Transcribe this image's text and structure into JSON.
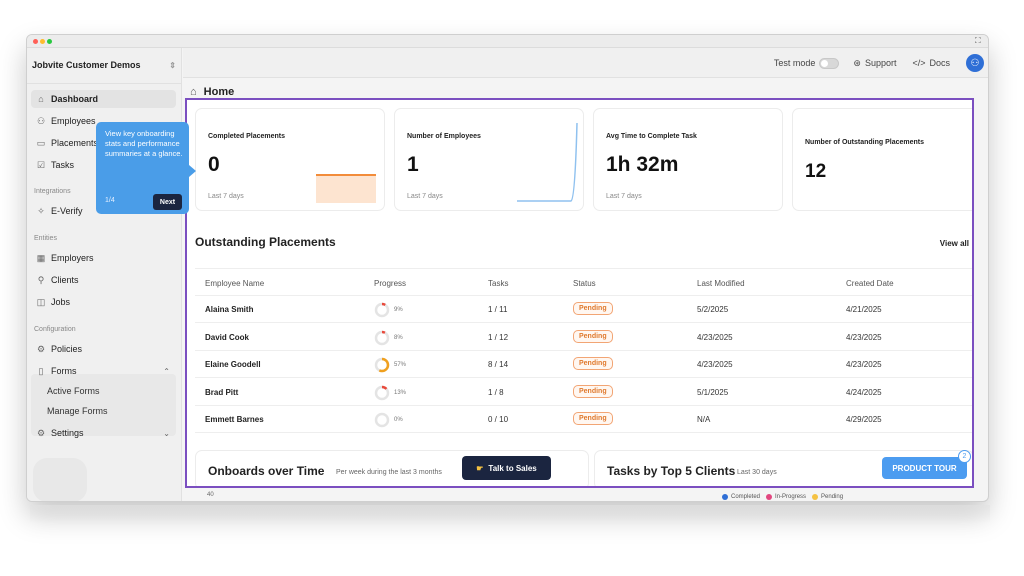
{
  "sidebar": {
    "org_name": "Jobvite Customer Demos",
    "items": {
      "dashboard": "Dashboard",
      "employees": "Employees",
      "placements": "Placements",
      "tasks": "Tasks",
      "everify": "E-Verify",
      "employers": "Employers",
      "clients": "Clients",
      "jobs": "Jobs",
      "policies": "Policies",
      "forms": "Forms",
      "active_forms": "Active Forms",
      "manage_forms": "Manage Forms",
      "settings": "Settings"
    },
    "sections": {
      "integrations": "Integrations",
      "entities": "Entities",
      "configuration": "Configuration"
    }
  },
  "topbar": {
    "test_mode": "Test mode",
    "support": "Support",
    "docs": "Docs",
    "test_mode_on": false
  },
  "breadcrumb": {
    "title": "Home"
  },
  "cards": [
    {
      "title": "Completed Placements",
      "value": "0",
      "sub": "Last 7 days"
    },
    {
      "title": "Number of Employees",
      "value": "1",
      "sub": "Last 7 days"
    },
    {
      "title": "Avg Time to Complete Task",
      "value": "1h 32m",
      "sub": "Last 7 days"
    },
    {
      "title": "Number of Outstanding Placements",
      "value": "12",
      "sub": ""
    }
  ],
  "outstanding": {
    "title": "Outstanding Placements",
    "view_all": "View all",
    "columns": [
      "Employee Name",
      "Progress",
      "Tasks",
      "Status",
      "Last Modified",
      "Created Date"
    ],
    "rows": [
      {
        "name": "Alaina Smith",
        "progress": "9%",
        "progress_value": 0.09,
        "tasks": "1 / 11",
        "status": "Pending",
        "modified": "5/2/2025",
        "created": "4/21/2025"
      },
      {
        "name": "David Cook",
        "progress": "8%",
        "progress_value": 0.08,
        "tasks": "1 / 12",
        "status": "Pending",
        "modified": "4/23/2025",
        "created": "4/23/2025"
      },
      {
        "name": "Elaine Goodell",
        "progress": "57%",
        "progress_value": 0.57,
        "tasks": "8 / 14",
        "status": "Pending",
        "modified": "4/23/2025",
        "created": "4/23/2025"
      },
      {
        "name": "Brad Pitt",
        "progress": "13%",
        "progress_value": 0.13,
        "tasks": "1 / 8",
        "status": "Pending",
        "modified": "5/1/2025",
        "created": "4/24/2025"
      },
      {
        "name": "Emmett Barnes",
        "progress": "0%",
        "progress_value": 0.0,
        "tasks": "0 / 10",
        "status": "Pending",
        "modified": "N/A",
        "created": "4/29/2025"
      }
    ]
  },
  "onboards": {
    "title": "Onboards over Time",
    "sub": "Per week during the last 3 months",
    "axis_top": "40"
  },
  "top_clients": {
    "title": "Tasks by Top 5 Clients",
    "sub": "Last 30 days",
    "legend": [
      "Completed",
      "In-Progress",
      "Pending"
    ]
  },
  "tooltip": {
    "text": "View key onboarding stats and performance summaries at a glance.",
    "step": "1/4",
    "next": "Next"
  },
  "talk_to_sales": "Talk to Sales",
  "product_tour": {
    "label": "PRODUCT TOUR",
    "count": "2"
  },
  "colors": {
    "accent": "#7b4fc0",
    "tooltip": "#4a9de8",
    "dark_button": "#1b2540",
    "pending": "#e07a2e",
    "completed_legend": "#2f6fd6",
    "inprogress_legend": "#e2467f",
    "pending_legend": "#f5c242",
    "progress_ring_low": "#e84a3c",
    "progress_ring_mid": "#f0a01e"
  },
  "icons": {
    "dashboard": "home-icon",
    "employees": "person-icon",
    "placements": "folder-icon",
    "tasks": "checkbox-icon",
    "everify": "badge-icon",
    "employers": "building-icon",
    "clients": "org-chart-icon",
    "jobs": "briefcase-icon",
    "policies": "gear-icon",
    "forms": "document-icon",
    "settings": "settings-icon"
  }
}
